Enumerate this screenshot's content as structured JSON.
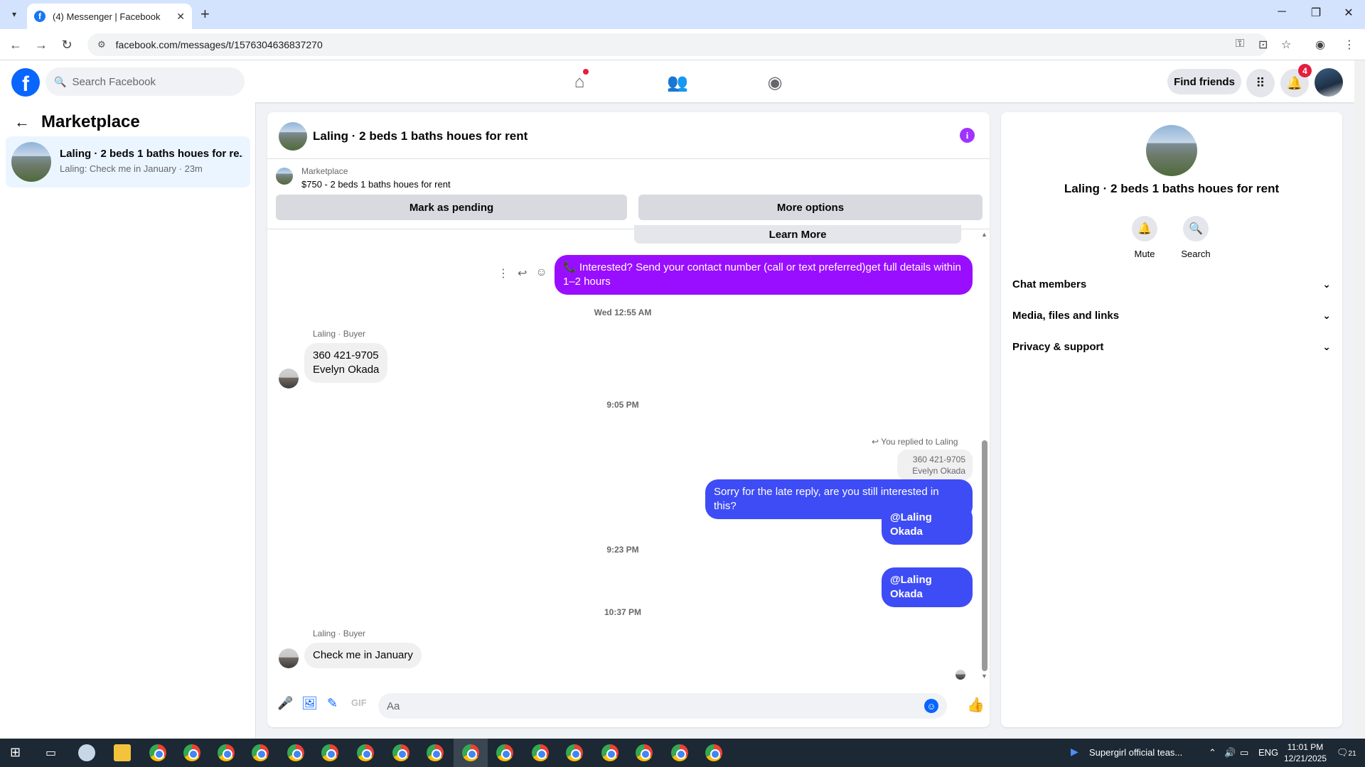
{
  "browser": {
    "tab_title": "(4) Messenger | Facebook",
    "url": "facebook.com/messages/t/1576304636837270"
  },
  "fb_header": {
    "search_placeholder": "Search Facebook",
    "find_friends": "Find friends",
    "notification_count": "4"
  },
  "left_panel": {
    "title": "Marketplace",
    "conversation": {
      "title": "Laling · 2 beds 1 baths houes for re...",
      "subtitle": "Laling: Check me in January · 23m"
    }
  },
  "chat": {
    "title": "Laling · 2 beds 1 baths houes for rent",
    "marketplace_label": "Marketplace",
    "listing": "$750 - 2 beds 1 baths houes for rent",
    "mark_pending": "Mark as pending",
    "more_options": "More options",
    "learn_more": "Learn More",
    "messages": [
      {
        "type": "sent",
        "text": "📞 Interested? Send your contact number (call or text preferred)get full details within 1–2 hours"
      },
      {
        "type": "timestamp",
        "text": "Wed 12:55 AM"
      },
      {
        "type": "sender",
        "text": "Laling · Buyer"
      },
      {
        "type": "received",
        "line1": "360 421-9705",
        "line2": "Evelyn Okada"
      },
      {
        "type": "timestamp",
        "text": "9:05 PM"
      },
      {
        "type": "reply_note",
        "text": "You replied to Laling"
      },
      {
        "type": "quoted",
        "line1": "360 421-9705",
        "line2": "Evelyn Okada"
      },
      {
        "type": "sent",
        "text": "Sorry for the late reply, are you still interested in this?"
      },
      {
        "type": "sent",
        "text": "@Laling Okada"
      },
      {
        "type": "timestamp",
        "text": "9:23 PM"
      },
      {
        "type": "sent",
        "text": "@Laling Okada"
      },
      {
        "type": "timestamp",
        "text": "10:37 PM"
      },
      {
        "type": "sender",
        "text": "Laling · Buyer"
      },
      {
        "type": "received",
        "text": "Check me in January"
      }
    ],
    "composer_placeholder": "Aa"
  },
  "right_panel": {
    "title": "Laling · 2 beds 1 baths houes for rent",
    "mute": "Mute",
    "search": "Search",
    "sections": [
      "Chat members",
      "Media, files and links",
      "Privacy & support"
    ]
  },
  "taskbar": {
    "media_title": "Supergirl official teas...",
    "lang": "ENG",
    "time": "11:01 PM",
    "date": "12/21/2025",
    "notif_count": "21"
  },
  "colors": {
    "accent_blue": "#0866ff",
    "sent_purple": "#9a0eff",
    "sent_blue": "#3e4cf5",
    "selected_bg": "#ebf5ff"
  }
}
